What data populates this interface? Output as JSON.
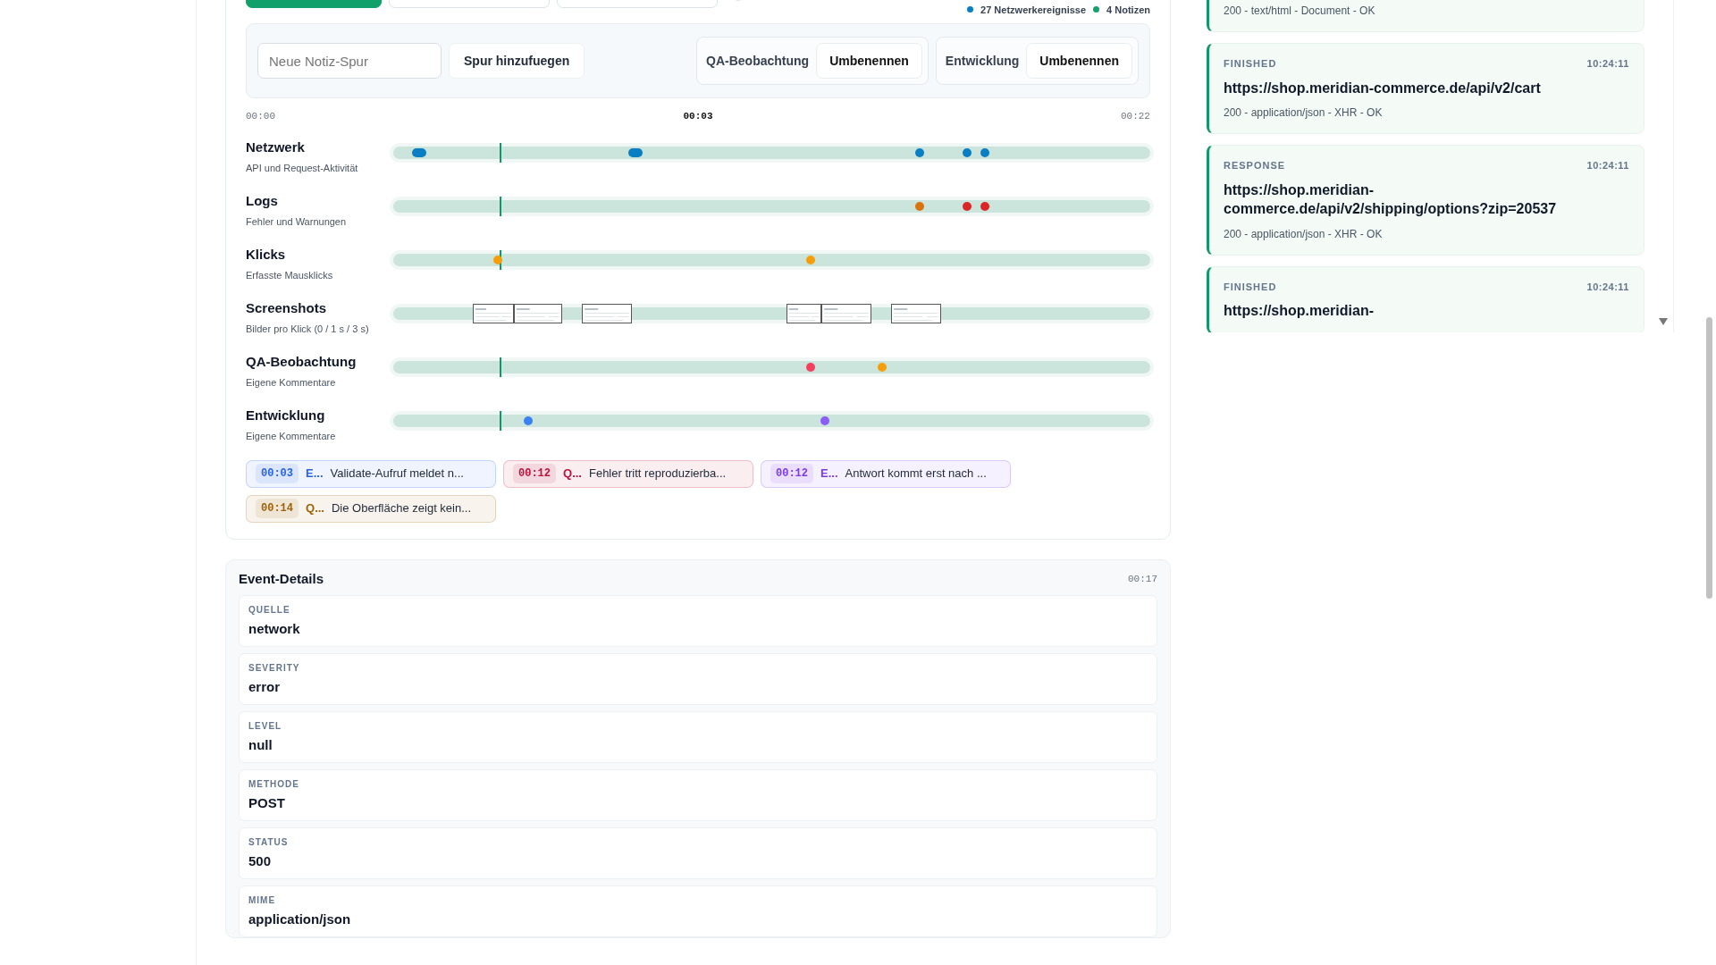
{
  "legend": [
    {
      "label": "27 Netzwerkereignisse",
      "color": "#0a7ec2"
    },
    {
      "label": "4 Notizen",
      "color": "#10a36b"
    }
  ],
  "toolbar": {
    "input": {
      "placeholder": "Neue Notiz-Spur"
    },
    "add_button": "Spur hinzufuegen",
    "note_tracks": [
      {
        "label": "QA-Beobachtung",
        "button": "Umbenennen"
      },
      {
        "label": "Entwicklung",
        "button": "Umbenennen"
      }
    ]
  },
  "axis": {
    "start": "00:00",
    "cursor": "00:03",
    "end": "00:22"
  },
  "tracks": [
    {
      "kind": "dots",
      "title": "Netzwerk",
      "subtitle": "API und Request-Aktivität",
      "markers": [
        {
          "color": "#0a7ec2"
        },
        {
          "color": "#0a7ec2"
        },
        {
          "color": "#0a7ec2"
        },
        {
          "color": "#0a7ec2"
        },
        {
          "color": "#0a7ec2"
        }
      ]
    },
    {
      "kind": "dots",
      "title": "Logs",
      "subtitle": "Fehler und Warnungen",
      "markers": [
        {
          "color": "#d9730d"
        },
        {
          "color": "#dc2626"
        },
        {
          "color": "#dc2626"
        }
      ]
    },
    {
      "kind": "dots",
      "title": "Klicks",
      "subtitle": "Erfasste Mausklicks",
      "markers": [
        {
          "color": "#f59e0b"
        },
        {
          "color": "#f59e0b"
        }
      ]
    },
    {
      "kind": "thumbs",
      "title": "Screenshots",
      "subtitle": "Bilder pro Klick (0 / 1 s / 3 s)"
    },
    {
      "kind": "dots",
      "title": "QA-Beobachtung",
      "subtitle": "Eigene Kommentare",
      "markers": [
        {
          "color": "#f43f5e"
        },
        {
          "color": "#f59e0b"
        }
      ]
    },
    {
      "kind": "dots",
      "title": "Entwicklung",
      "subtitle": "Eigene Kommentare",
      "markers": [
        {
          "color": "#3b82f6"
        },
        {
          "color": "#8b5cf6"
        }
      ]
    }
  ],
  "notes": [
    {
      "time": "00:03",
      "track": "E...",
      "text": "Validate-Aufruf meldet n...",
      "color": "#2563eb"
    },
    {
      "time": "00:12",
      "track": "Q...",
      "text": "Fehler tritt reproduzierba...",
      "color": "#be123c"
    },
    {
      "time": "00:12",
      "track": "E...",
      "text": "Antwort kommt erst nach ...",
      "color": "#7c3aed"
    },
    {
      "time": "00:14",
      "track": "Q...",
      "text": "Die Oberfläche zeigt kein...",
      "color": "#a16207"
    }
  ],
  "event_details": {
    "title": "Event-Details",
    "time": "00:17",
    "fields": [
      {
        "label": "QUELLE",
        "value": "network"
      },
      {
        "label": "SEVERITY",
        "value": "error"
      },
      {
        "label": "LEVEL",
        "value": "null"
      },
      {
        "label": "METHODE",
        "value": "POST"
      },
      {
        "label": "STATUS",
        "value": "500"
      },
      {
        "label": "MIME",
        "value": "application/json"
      }
    ]
  },
  "network_feed": [
    {
      "meta": "200 - text/html - Document - OK"
    },
    {
      "status": "FINISHED",
      "time": "10:24:11",
      "url": "https://shop.meridian-commerce.de/api/v2/cart",
      "meta": "200 - application/json - XHR - OK"
    },
    {
      "status": "RESPONSE",
      "time": "10:24:11",
      "url": "https://shop.meridian-commerce.de/api/v2/shipping/options?zip=20537",
      "meta": "200 - application/json - XHR - OK"
    },
    {
      "status": "FINISHED",
      "time": "10:24:11",
      "url": "https://shop.meridian-"
    }
  ]
}
